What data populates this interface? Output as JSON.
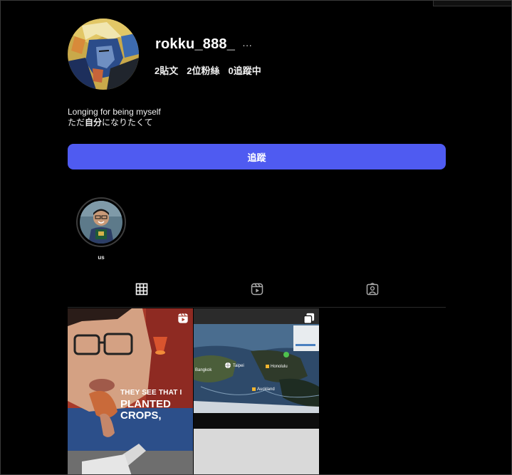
{
  "profile": {
    "username": "rokku_888_",
    "more_label": "···",
    "stats": {
      "posts": "2貼文",
      "followers": "2位粉絲",
      "following": "0追蹤中"
    },
    "bio": {
      "line1": "Longing for being myself",
      "line2_pre": "ただ",
      "line2_emph": "自分",
      "line2_post": "になりたくて"
    },
    "follow_label": "追蹤"
  },
  "highlights": [
    {
      "label": "us"
    }
  ],
  "tabs": [
    {
      "name": "posts",
      "icon": "grid-icon",
      "active": true
    },
    {
      "name": "reels",
      "icon": "reels-icon",
      "active": false
    },
    {
      "name": "tagged",
      "icon": "tagged-icon",
      "active": false
    }
  ],
  "posts": [
    {
      "type": "reel",
      "badge_icon": "reel-icon",
      "caption": {
        "line1": "THEY SEE THAT I",
        "line2": "PLANTED",
        "line3": "CROPS,"
      }
    },
    {
      "type": "carousel",
      "badge_icon": "carousel-icon",
      "map_labels": [
        "Taipei",
        "Honolulu",
        "Auckland",
        "Bangkok"
      ]
    }
  ],
  "colors": {
    "background": "#000000",
    "follow_button": "#4f5bf1",
    "text": "#f5f5f5"
  }
}
